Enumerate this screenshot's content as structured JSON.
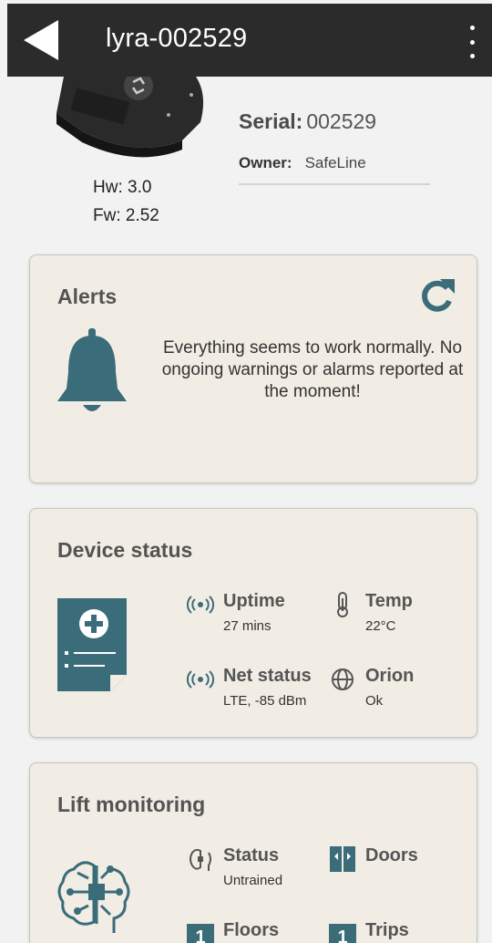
{
  "header": {
    "title": "lyra-002529",
    "back_icon": "back-arrow-icon",
    "menu_icon": "more-vert-icon"
  },
  "device": {
    "hw": "Hw: 3.0",
    "fw": "Fw: 2.52",
    "serial_label": "Serial:",
    "serial_value": "002529",
    "owner_label": "Owner:",
    "owner_value": "SafeLine"
  },
  "alerts": {
    "title": "Alerts",
    "message": "Everything seems to work normally. No ongoing warnings or alarms reported at the moment!",
    "refresh_icon": "refresh-icon",
    "bell_icon": "bell-icon"
  },
  "device_status": {
    "title": "Device status",
    "items": [
      {
        "label": "Uptime",
        "value": "27 mins",
        "icon": "signal-icon"
      },
      {
        "label": "Temp",
        "value": "22°C",
        "icon": "thermometer-icon"
      },
      {
        "label": "Net status",
        "value": "LTE, -85 dBm",
        "icon": "signal-icon"
      },
      {
        "label": "Orion",
        "value": "Ok",
        "icon": "globe-icon"
      }
    ]
  },
  "lift_monitoring": {
    "title": "Lift monitoring",
    "items": [
      {
        "label": "Status",
        "value": "Untrained",
        "icon": "brain-chip-icon"
      },
      {
        "label": "Doors",
        "value": "",
        "icon": "doors-icon"
      },
      {
        "label": "Floors",
        "badge": "1"
      },
      {
        "label": "Trips",
        "badge": "1"
      }
    ]
  },
  "colors": {
    "accent": "#3a6c7a",
    "card_bg": "#f1ede4",
    "topbar": "#2b2b2b"
  }
}
